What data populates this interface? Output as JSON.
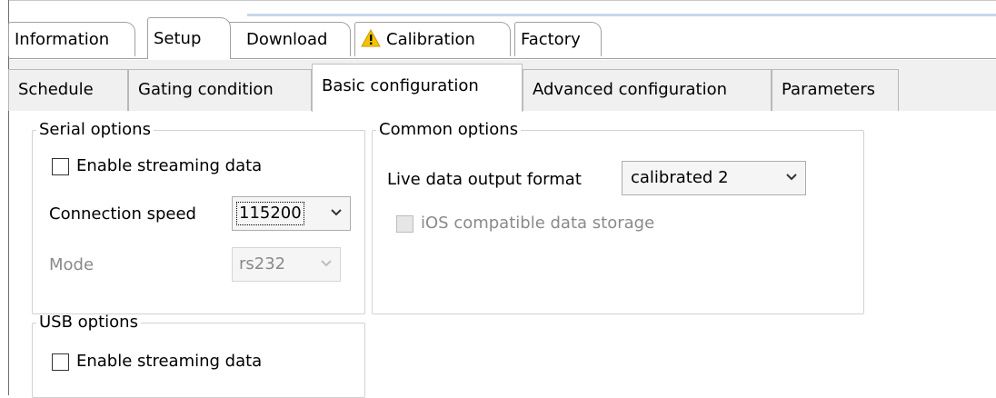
{
  "top_tabs": [
    {
      "label": "Information",
      "selected": false
    },
    {
      "label": "Setup",
      "selected": true
    },
    {
      "label": "Download",
      "selected": false
    },
    {
      "label": "Calibration",
      "selected": false,
      "icon": "warning-icon"
    },
    {
      "label": "Factory",
      "selected": false
    }
  ],
  "sub_tabs": [
    {
      "label": "Schedule",
      "selected": false
    },
    {
      "label": "Gating condition",
      "selected": false
    },
    {
      "label": "Basic configuration",
      "selected": true
    },
    {
      "label": "Advanced configuration",
      "selected": false
    },
    {
      "label": "Parameters",
      "selected": false
    }
  ],
  "serial_options": {
    "title": "Serial options",
    "enable_streaming_label": "Enable streaming data",
    "enable_streaming_checked": false,
    "connection_speed_label": "Connection speed",
    "connection_speed_value": "115200",
    "mode_label": "Mode",
    "mode_value": "rs232",
    "mode_enabled": false
  },
  "usb_options": {
    "title": "USB options",
    "enable_streaming_label": "Enable streaming data",
    "enable_streaming_checked": false
  },
  "common_options": {
    "title": "Common options",
    "live_format_label": "Live data output format",
    "live_format_value": "calibrated 2",
    "ios_storage_label": "iOS compatible data storage",
    "ios_storage_enabled": false,
    "ios_storage_checked": false
  },
  "colors": {
    "window_bg": "#ffffff",
    "tab_strip_bg": "#f0f0f0",
    "warning_yellow": "#f5c400"
  }
}
